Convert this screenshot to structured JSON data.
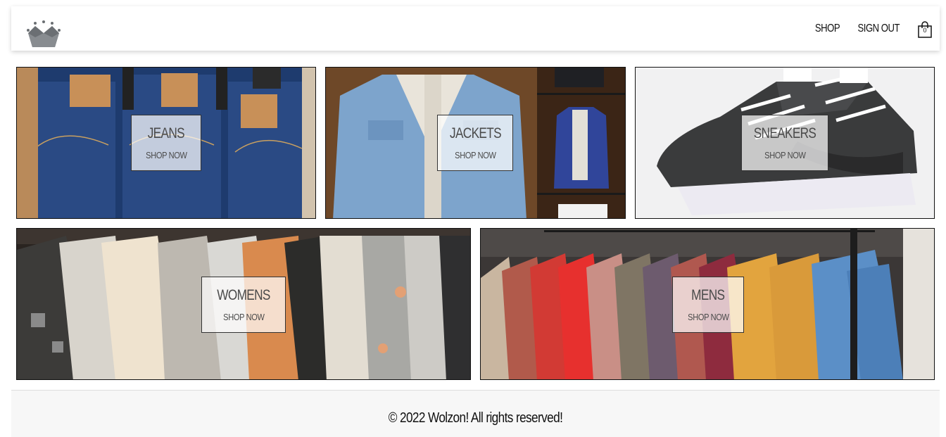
{
  "header": {
    "logo": "crown-logo",
    "nav": {
      "shop": "SHOP",
      "sign_out": "SIGN OUT"
    },
    "cart": {
      "icon": "shopping-bag-icon",
      "count": "0"
    }
  },
  "categories": [
    {
      "title": "JEANS",
      "cta": "SHOP NOW"
    },
    {
      "title": "JACKETS",
      "cta": "SHOP NOW"
    },
    {
      "title": "SNEAKERS",
      "cta": "SHOP NOW"
    },
    {
      "title": "WOMENS",
      "cta": "SHOP NOW"
    },
    {
      "title": "MENS",
      "cta": "SHOP NOW"
    }
  ],
  "footer": {
    "copyright": "© 2022 Wolzon! All rights reserved!"
  },
  "colors": {
    "accent": "#111111",
    "footer_bg": "#f7f7f7",
    "label_bg": "#ffffff"
  }
}
